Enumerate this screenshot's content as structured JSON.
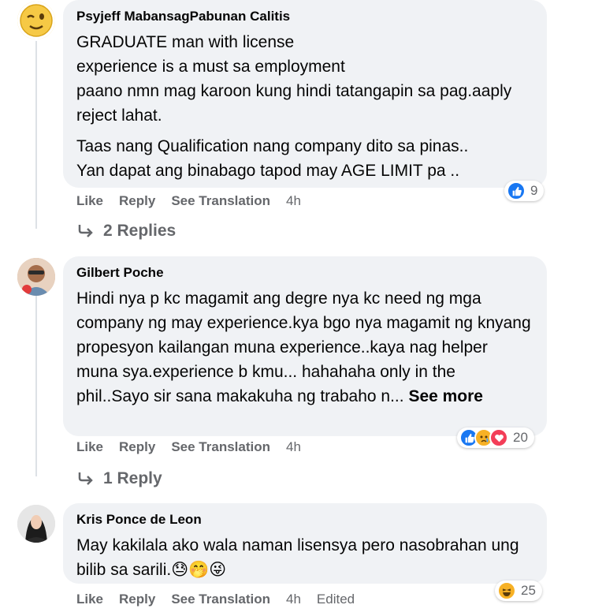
{
  "comments": [
    {
      "author": "Psyjeff MabansagPabunan Calitis",
      "text1": "GRADUATE man with license\nexperience is a must sa employment\npaano nmn mag karoon kung hindi tatangapin sa pag.aaply reject lahat.",
      "text2": "Taas nang Qualification nang company dito sa pinas..\nYan dapat ang binabago tapod may AGE LIMIT pa ..",
      "actions": {
        "like": "Like",
        "reply": "Reply",
        "translate": "See Translation",
        "time": "4h"
      },
      "reaction_count": "9",
      "reaction_types": [
        "like-icon"
      ],
      "replies_label": "2 Replies"
    },
    {
      "author": "Gilbert Poche",
      "text1": "Hindi nya p kc magamit ang degre nya kc need ng mga company ng may experience.kya bgo nya magamit ng knyang propesyon kailangan muna experience..kaya nag helper muna sya.experience b kmu... hahahaha only in the phil..Sayo sir sana makakuha ng trabaho n...",
      "see_more": "See more",
      "actions": {
        "like": "Like",
        "reply": "Reply",
        "translate": "See Translation",
        "time": "4h"
      },
      "reaction_count": "20",
      "reaction_types": [
        "like-icon",
        "sad-icon",
        "love-icon"
      ],
      "replies_label": "1 Reply"
    },
    {
      "author": "Kris Ponce de Leon",
      "text1": "May kakilala ako wala naman lisensya pero nasobrahan ung bilib sa sarili.",
      "emojis": [
        "😓",
        "🤭",
        "😜"
      ],
      "actions": {
        "like": "Like",
        "reply": "Reply",
        "translate": "See Translation",
        "time": "4h",
        "edited": "Edited"
      },
      "reaction_count": "25",
      "reaction_types": [
        "haha-icon"
      ]
    }
  ],
  "colors": {
    "bubble": "#f0f2f5",
    "meta": "#65676b",
    "like": "#1877f2",
    "love": "#f33e58",
    "emoji_yellow": "#f7b125"
  }
}
